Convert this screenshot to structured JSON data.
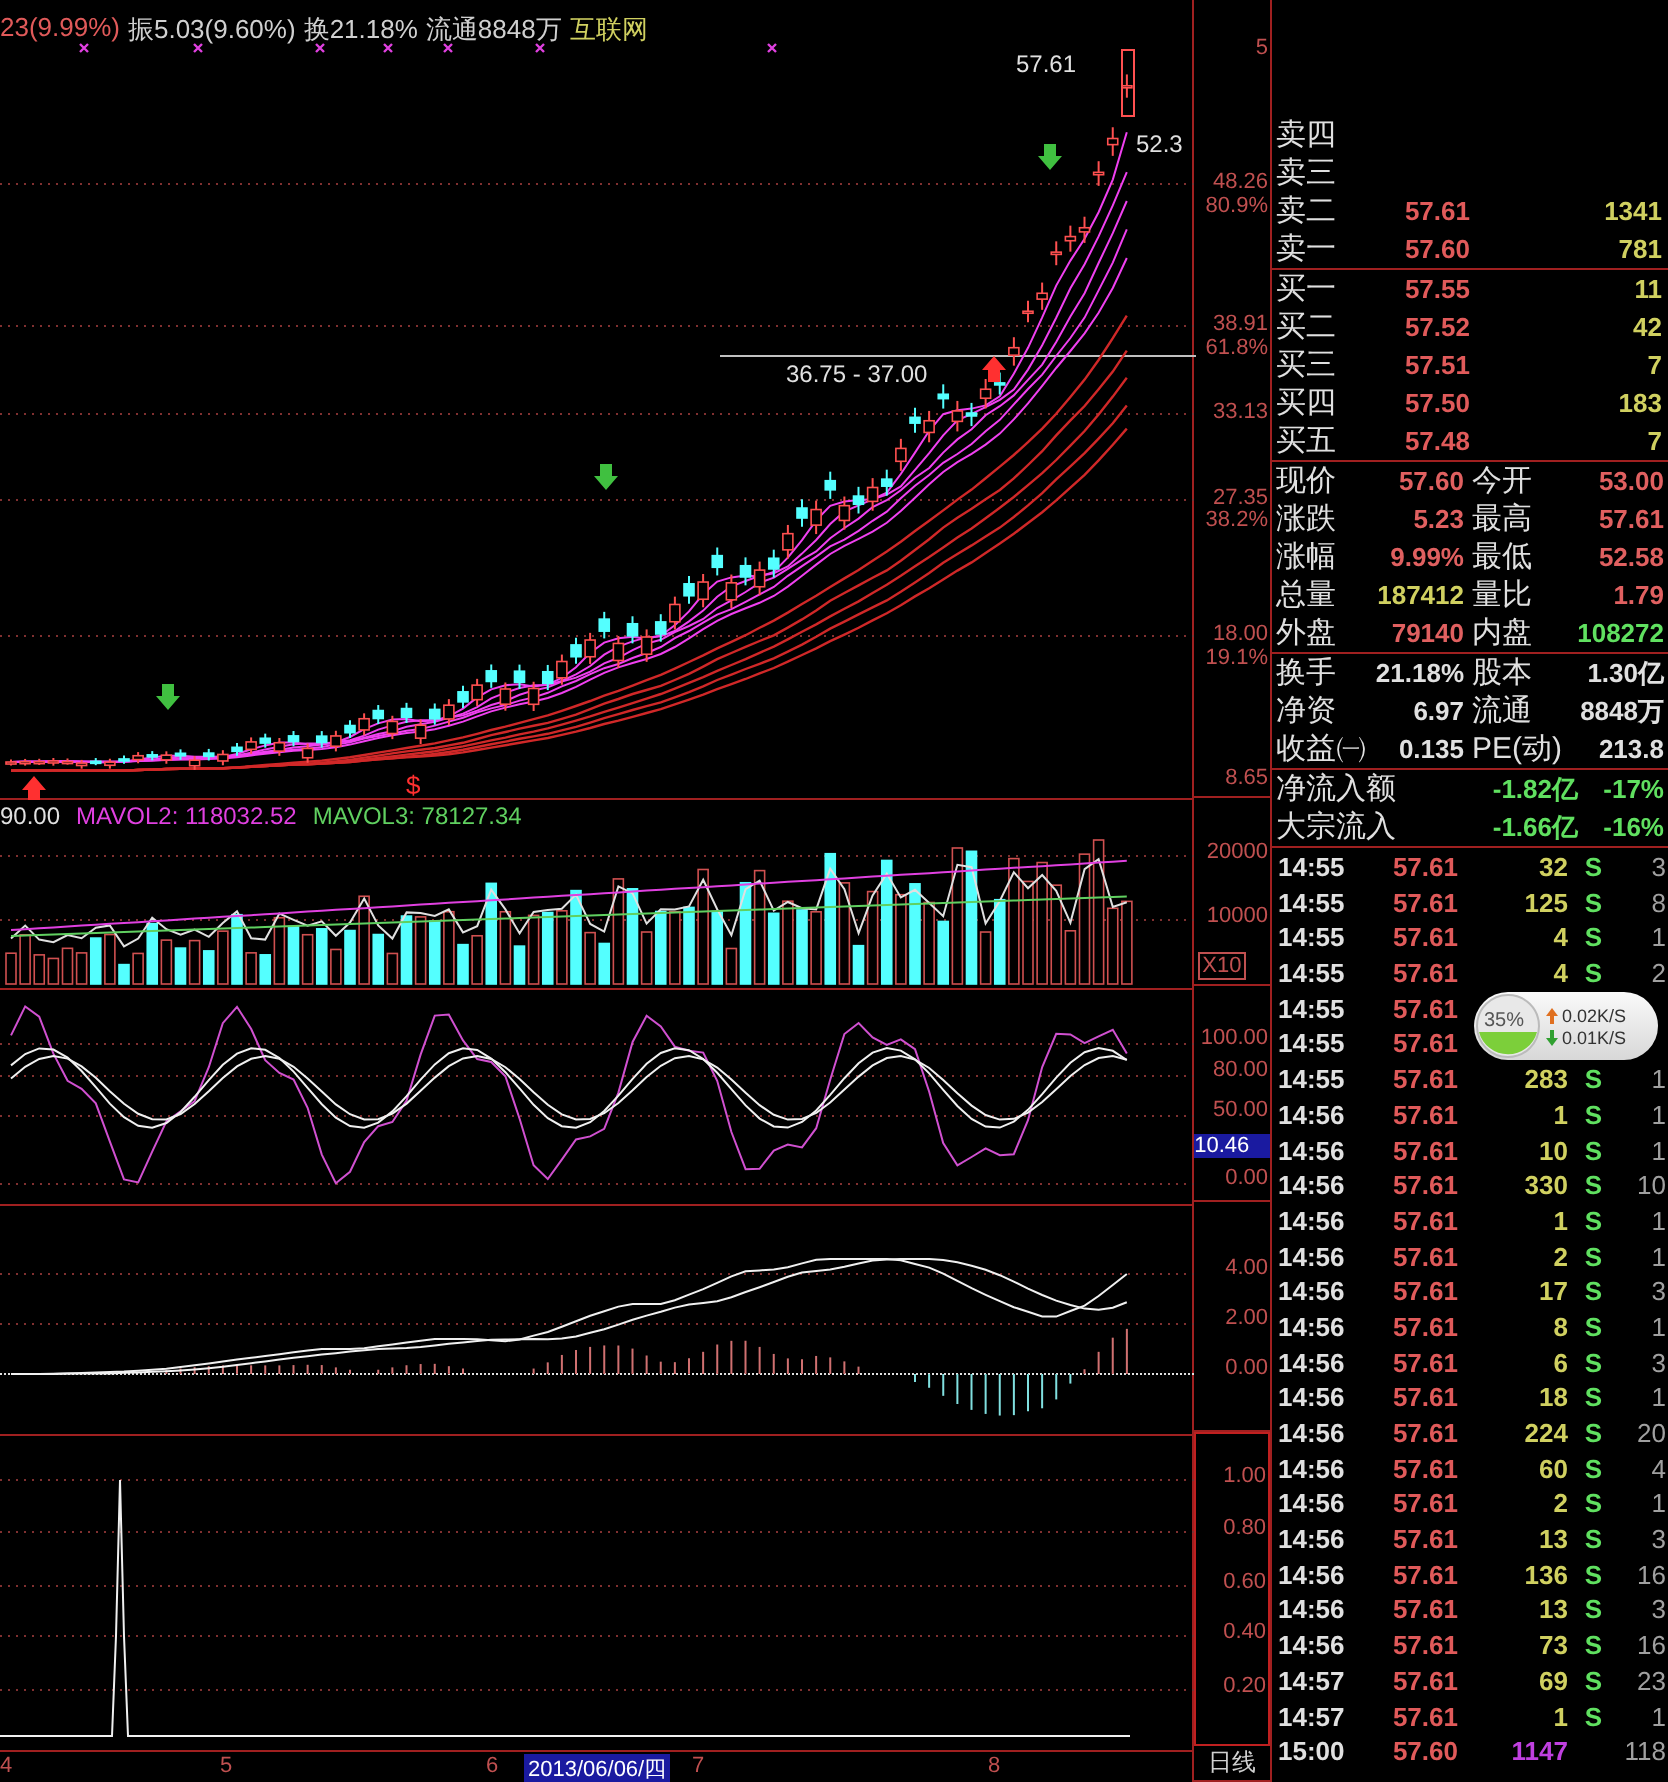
{
  "header": {
    "change": "23(9.99%)",
    "amplitude": "振5.03(9.60%)",
    "turnover": "换21.18%",
    "float_shares": "流通8848万",
    "sector": "互联网"
  },
  "main_chart": {
    "high_label": "57.61",
    "last_label": "52.3",
    "range_label": "36.75 - 37.00",
    "marker": "$",
    "axis": [
      "5",
      "48.26",
      "80.9%",
      "38.91",
      "61.8%",
      "33.13",
      "27.35",
      "38.2%",
      "18.00",
      "19.1%",
      "8.65"
    ]
  },
  "volume_panel": {
    "legend": [
      {
        "text": "90.00",
        "color": "#e0e0e0"
      },
      {
        "text": "MAVOL2: 118032.52",
        "color": "#e040e0"
      },
      {
        "text": "MAVOL3: 78127.34",
        "color": "#60d060"
      }
    ],
    "axis": [
      "20000",
      "10000"
    ],
    "scale": "X10"
  },
  "kdj_panel": {
    "axis": [
      "100.00",
      "80.00",
      "50.00",
      "0.00"
    ],
    "cursor_value": "10.46"
  },
  "macd_panel": {
    "axis": [
      "4.00",
      "2.00",
      "0.00"
    ]
  },
  "bottom_panel": {
    "axis": [
      "1.00",
      "0.80",
      "0.60",
      "0.40",
      "0.20"
    ]
  },
  "x_axis": {
    "labels": [
      "4",
      "5",
      "6",
      "7",
      "8"
    ],
    "cursor_date": "2013/06/06/四",
    "period": "日线"
  },
  "order_book": {
    "asks": [
      {
        "label": "卖四"
      },
      {
        "label": "卖三"
      },
      {
        "label": "卖二",
        "price": "57.61",
        "volume": "1341"
      },
      {
        "label": "卖一",
        "price": "57.60",
        "volume": "781"
      }
    ],
    "bids": [
      {
        "label": "买一",
        "price": "57.55",
        "volume": "11"
      },
      {
        "label": "买二",
        "price": "57.52",
        "volume": "42"
      },
      {
        "label": "买三",
        "price": "57.51",
        "volume": "7"
      },
      {
        "label": "买四",
        "price": "57.50",
        "volume": "183"
      },
      {
        "label": "买五",
        "price": "57.48",
        "volume": "7"
      }
    ]
  },
  "quote": [
    {
      "label": "现价",
      "value": "57.60",
      "color": "#e06060"
    },
    {
      "label": "今开",
      "value": "53.00",
      "color": "#e06060"
    },
    {
      "label": "涨跌",
      "value": "5.23",
      "color": "#e06060"
    },
    {
      "label": "最高",
      "value": "57.61",
      "color": "#e06060"
    },
    {
      "label": "涨幅",
      "value": "9.99%",
      "color": "#e06060"
    },
    {
      "label": "最低",
      "value": "52.58",
      "color": "#e06060"
    },
    {
      "label": "总量",
      "value": "187412",
      "color": "#d0d060"
    },
    {
      "label": "量比",
      "value": "1.79",
      "color": "#e06060"
    },
    {
      "label": "外盘",
      "value": "79140",
      "color": "#e06060"
    },
    {
      "label": "内盘",
      "value": "108272",
      "color": "#60e060"
    }
  ],
  "fundamentals": [
    {
      "label": "换手",
      "value": "21.18%"
    },
    {
      "label": "股本",
      "value": "1.30亿"
    },
    {
      "label": "净资",
      "value": "6.97"
    },
    {
      "label": "流通",
      "value": "8848万"
    },
    {
      "label": "收益㈠",
      "value": "0.135"
    },
    {
      "label": "PE(动)",
      "value": "213.8"
    }
  ],
  "flows": [
    {
      "label": "净流入额",
      "amount": "-1.82亿",
      "ratio": "-17%"
    },
    {
      "label": "大宗流入",
      "amount": "-1.66亿",
      "ratio": "-16%"
    }
  ],
  "ticks": [
    {
      "time": "14:55",
      "price": "57.61",
      "volume": "32",
      "side": "S",
      "count": "3",
      "kind": "trade"
    },
    {
      "time": "14:55",
      "price": "57.61",
      "volume": "125",
      "side": "S",
      "count": "8",
      "kind": "trade"
    },
    {
      "time": "14:55",
      "price": "57.61",
      "volume": "4",
      "side": "S",
      "count": "1",
      "kind": "trade"
    },
    {
      "time": "14:55",
      "price": "57.61",
      "volume": "4",
      "side": "S",
      "count": "2",
      "kind": "trade"
    },
    {
      "time": "14:55",
      "price": "57.61",
      "kind": "trade"
    },
    {
      "time": "14:55",
      "price": "57.61",
      "kind": "trade"
    },
    {
      "time": "14:55",
      "price": "57.61",
      "volume": "283",
      "side": "S",
      "count": "1",
      "kind": "trade"
    },
    {
      "time": "14:56",
      "price": "57.61",
      "volume": "1",
      "side": "S",
      "count": "1",
      "kind": "trade"
    },
    {
      "time": "14:56",
      "price": "57.61",
      "volume": "10",
      "side": "S",
      "count": "1",
      "kind": "trade"
    },
    {
      "time": "14:56",
      "price": "57.61",
      "volume": "330",
      "side": "S",
      "count": "10",
      "kind": "trade"
    },
    {
      "time": "14:56",
      "price": "57.61",
      "volume": "1",
      "side": "S",
      "count": "1",
      "kind": "trade"
    },
    {
      "time": "14:56",
      "price": "57.61",
      "volume": "2",
      "side": "S",
      "count": "1",
      "kind": "trade"
    },
    {
      "time": "14:56",
      "price": "57.61",
      "volume": "17",
      "side": "S",
      "count": "3",
      "kind": "trade"
    },
    {
      "time": "14:56",
      "price": "57.61",
      "volume": "8",
      "side": "S",
      "count": "1",
      "kind": "trade"
    },
    {
      "time": "14:56",
      "price": "57.61",
      "volume": "6",
      "side": "S",
      "count": "3",
      "kind": "trade"
    },
    {
      "time": "14:56",
      "price": "57.61",
      "volume": "18",
      "side": "S",
      "count": "1",
      "kind": "trade"
    },
    {
      "time": "14:56",
      "price": "57.61",
      "volume": "224",
      "side": "S",
      "count": "20",
      "kind": "trade"
    },
    {
      "time": "14:56",
      "price": "57.61",
      "volume": "60",
      "side": "S",
      "count": "4",
      "kind": "trade"
    },
    {
      "time": "14:56",
      "price": "57.61",
      "volume": "2",
      "side": "S",
      "count": "1",
      "kind": "trade"
    },
    {
      "time": "14:56",
      "price": "57.61",
      "volume": "13",
      "side": "S",
      "count": "3",
      "kind": "trade"
    },
    {
      "time": "14:56",
      "price": "57.61",
      "volume": "136",
      "side": "S",
      "count": "16",
      "kind": "trade"
    },
    {
      "time": "14:56",
      "price": "57.61",
      "volume": "13",
      "side": "S",
      "count": "3",
      "kind": "trade"
    },
    {
      "time": "14:56",
      "price": "57.61",
      "volume": "73",
      "side": "S",
      "count": "16",
      "kind": "trade"
    },
    {
      "time": "14:57",
      "price": "57.61",
      "volume": "69",
      "side": "S",
      "count": "23",
      "kind": "trade"
    },
    {
      "time": "14:57",
      "price": "57.61",
      "volume": "1",
      "side": "S",
      "count": "1",
      "kind": "trade"
    },
    {
      "time": "15:00",
      "price": "57.60",
      "volume": "1147",
      "count": "118",
      "kind": "closing"
    }
  ],
  "network_widget": {
    "load": "35%",
    "upload": "0.02K/S",
    "download": "0.01K/S"
  }
}
